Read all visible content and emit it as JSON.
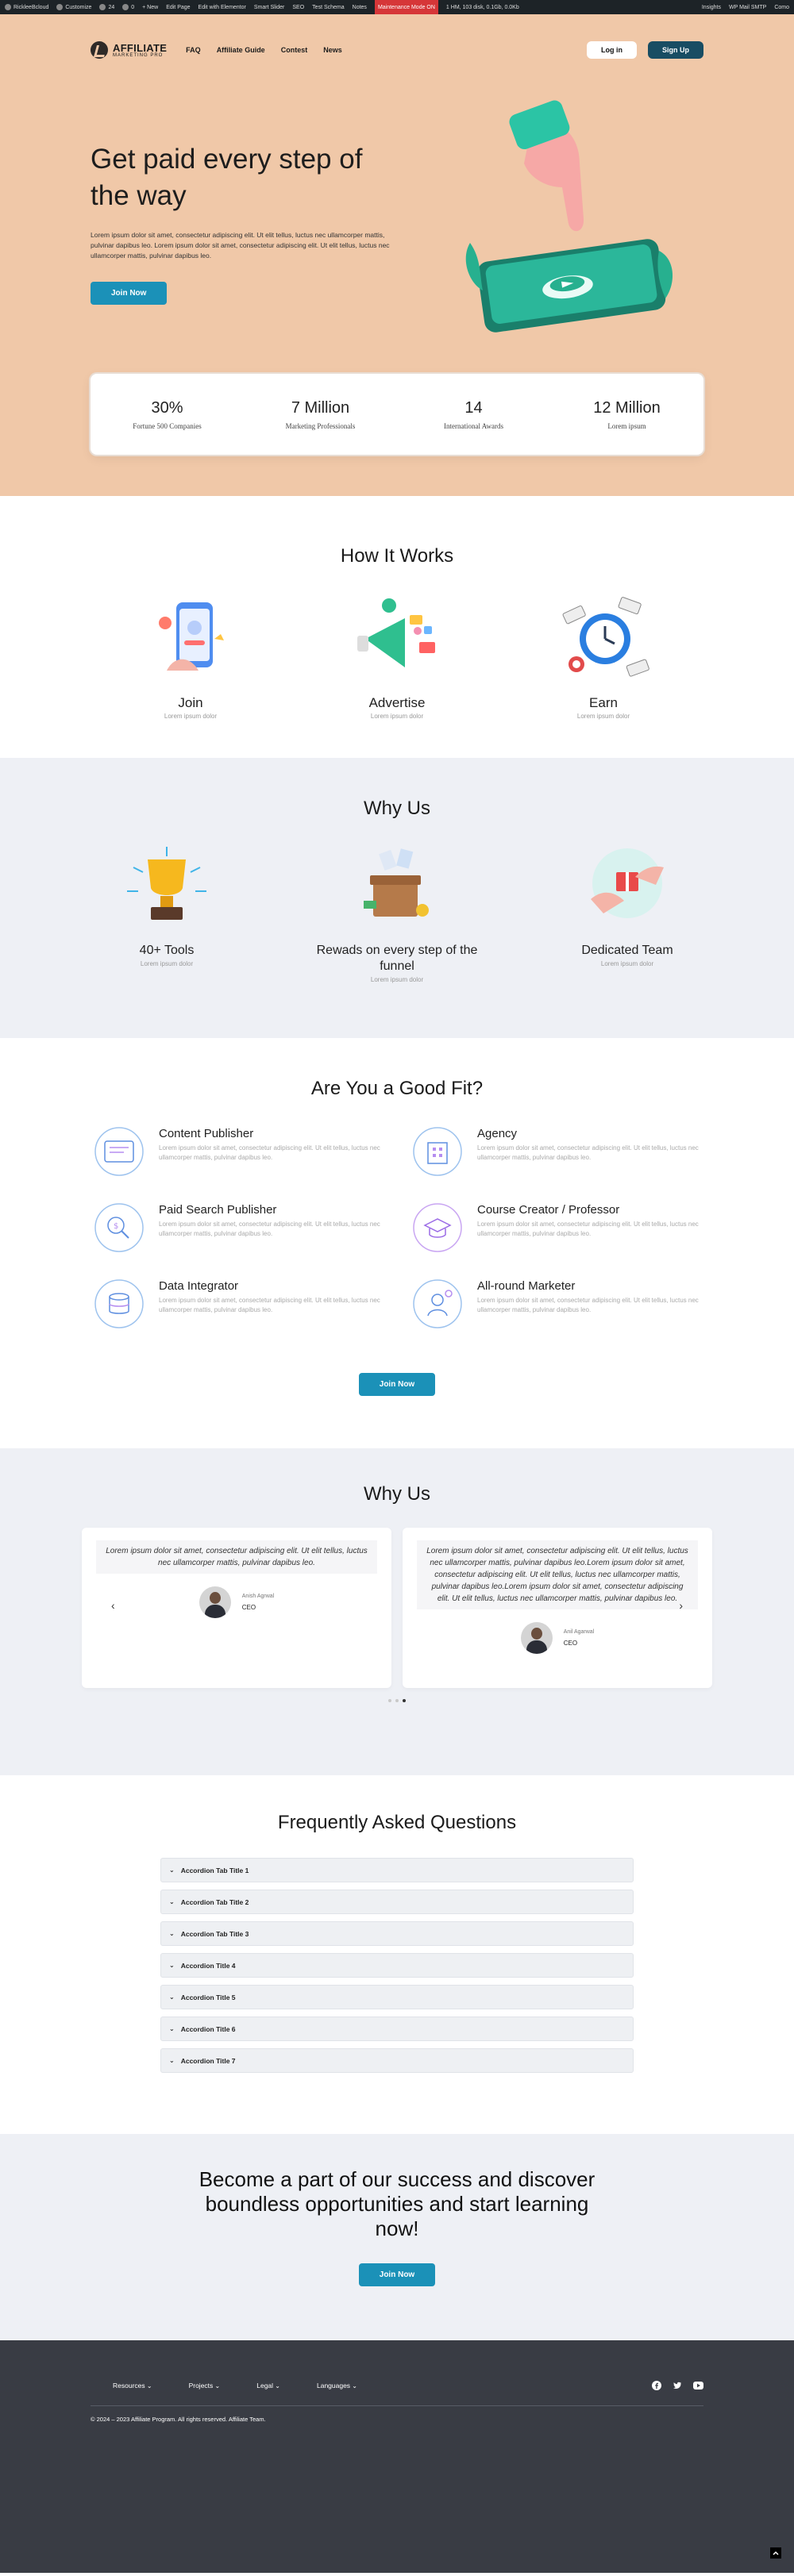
{
  "adminbar": {
    "items": [
      "RickleeBcloud",
      "Customize",
      "24",
      "0",
      "+ New",
      "Edit Page",
      "Edit with Elementor",
      "Smart Slider",
      "SEO",
      "Test Schema",
      "Notes"
    ],
    "alert": "Maintenance Mode ON",
    "perf": "1 HM, 103 disk, 0.1Gb, 0.0Kb",
    "right": [
      "Insights",
      "WP Mail SMTP",
      "Como"
    ]
  },
  "nav": {
    "logo_line1": "AFFILIATE",
    "logo_line2": "MARKETING PRO",
    "links": [
      "FAQ",
      "Affiliate Guide",
      "Contest",
      "News"
    ],
    "login": "Log in",
    "signup": "Sign Up"
  },
  "hero": {
    "title": "Get paid every step of the way",
    "desc": "Lorem ipsum dolor sit amet, consectetur adipiscing elit. Ut elit tellus, luctus nec ullamcorper mattis, pulvinar dapibus leo. Lorem ipsum dolor sit amet, consectetur adipiscing elit. Ut elit tellus, luctus nec ullamcorper mattis, pulvinar dapibus leo.",
    "cta": "Join Now"
  },
  "stats": [
    {
      "value": "30%",
      "label": "Fortune 500 Companies"
    },
    {
      "value": "7 Million",
      "label": "Marketing Professionals"
    },
    {
      "value": "14",
      "label": "International Awards"
    },
    {
      "value": "12 Million",
      "label": "Lorem ipsum"
    }
  ],
  "how": {
    "title": "How It Works",
    "items": [
      {
        "title": "Join",
        "sub": "Lorem ipsum dolor"
      },
      {
        "title": "Advertise",
        "sub": "Lorem ipsum dolor"
      },
      {
        "title": "Earn",
        "sub": "Lorem ipsum dolor"
      }
    ]
  },
  "why": {
    "title": "Why Us",
    "items": [
      {
        "title": "40+ Tools",
        "sub": "Lorem ipsum dolor"
      },
      {
        "title": "Rewads on every step of the funnel",
        "sub": "Lorem ipsum dolor"
      },
      {
        "title": "Dedicated Team",
        "sub": "Lorem ipsum dolor"
      }
    ]
  },
  "fit": {
    "title": "Are You a Good Fit?",
    "items": [
      {
        "title": "Content Publisher",
        "desc": "Lorem ipsum dolor sit amet, consectetur adipiscing elit. Ut elit tellus, luctus nec ullamcorper mattis, pulvinar dapibus leo."
      },
      {
        "title": "Agency",
        "desc": "Lorem ipsum dolor sit amet, consectetur adipiscing elit. Ut elit tellus, luctus nec ullamcorper mattis, pulvinar dapibus leo."
      },
      {
        "title": "Paid Search Publisher",
        "desc": "Lorem ipsum dolor sit amet, consectetur adipiscing elit. Ut elit tellus, luctus nec ullamcorper mattis, pulvinar dapibus leo."
      },
      {
        "title": "Course Creator / Professor",
        "desc": "Lorem ipsum dolor sit amet, consectetur adipiscing elit. Ut elit tellus, luctus nec ullamcorper mattis, pulvinar dapibus leo."
      },
      {
        "title": "Data Integrator",
        "desc": "Lorem ipsum dolor sit amet, consectetur adipiscing elit. Ut elit tellus, luctus nec ullamcorper mattis, pulvinar dapibus leo."
      },
      {
        "title": "All-round Marketer",
        "desc": "Lorem ipsum dolor sit amet, consectetur adipiscing elit. Ut elit tellus, luctus nec ullamcorper mattis, pulvinar dapibus leo."
      }
    ],
    "cta": "Join Now"
  },
  "testimonials": {
    "title": "Why Us",
    "prev": "‹",
    "next": "›",
    "items": [
      {
        "quote": "Lorem ipsum dolor sit amet, consectetur adipiscing elit. Ut elit tellus, luctus nec ullamcorper mattis, pulvinar dapibus leo.",
        "name": "Anish Agrwal",
        "role": "CEO"
      },
      {
        "quote": "Lorem ipsum dolor sit amet, consectetur adipiscing elit. Ut elit tellus, luctus nec ullamcorper mattis, pulvinar dapibus leo.Lorem ipsum dolor sit amet, consectetur adipiscing elit. Ut elit tellus, luctus nec ullamcorper mattis, pulvinar dapibus leo.Lorem ipsum dolor sit amet, consectetur adipiscing elit. Ut elit tellus, luctus nec ullamcorper mattis, pulvinar dapibus leo.",
        "name": "Anil Agarwal",
        "role": "CEO"
      }
    ]
  },
  "faq": {
    "title": "Frequently Asked Questions",
    "items": [
      "Accordion Tab Title 1",
      "Accordion Tab Title 2",
      "Accordion Tab Title 3",
      "Accordion Title 4",
      "Accordion Title 5",
      "Accordion Title 6",
      "Accordion Title 7"
    ]
  },
  "cta": {
    "title": "Become a part of our success and discover boundless opportunities and start learning now!",
    "button": "Join Now"
  },
  "footer": {
    "menus": [
      "Resources",
      "Projects",
      "Legal",
      "Languages"
    ],
    "copyright": "© 2024 – 2023 Affiliate Program. All rights reserved. Affiliate Team."
  },
  "colors": {
    "hero_bg": "#f0c8a8",
    "accent": "#1b91b8",
    "signup": "#184d63",
    "section_alt": "#eef0f5",
    "footer_bg": "#393c44"
  }
}
